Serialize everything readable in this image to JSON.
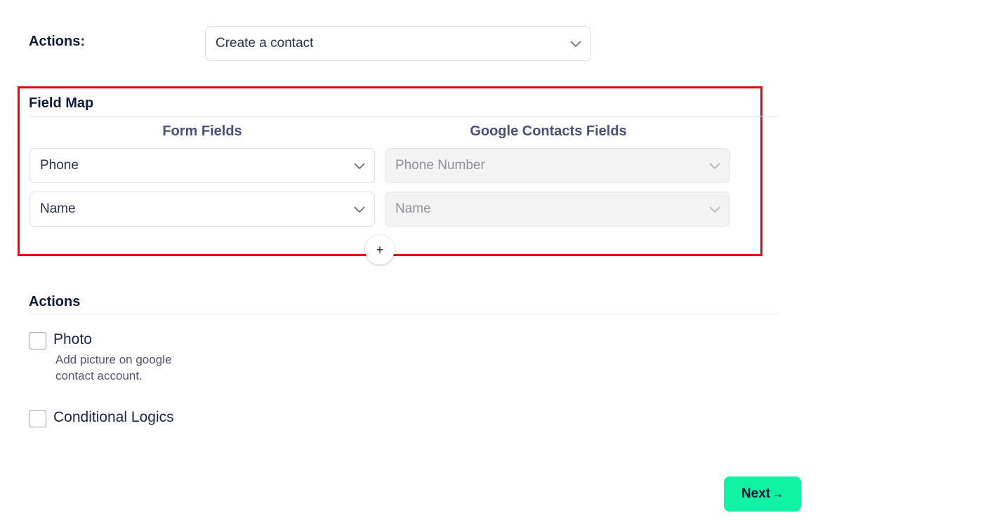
{
  "actions_row": {
    "label": "Actions:",
    "selected": "Create a contact"
  },
  "field_map": {
    "title": "Field Map",
    "form_fields_header": "Form Fields",
    "google_fields_header": "Google Contacts Fields",
    "rows": [
      {
        "form_field": "Phone",
        "google_field": "Phone Number"
      },
      {
        "form_field": "Name",
        "google_field": "Name"
      }
    ],
    "add_label": "+"
  },
  "actions_section": {
    "title": "Actions",
    "photo_label": "Photo",
    "photo_desc": "Add picture on google contact account.",
    "conditional_label": "Conditional Logics"
  },
  "next_button": {
    "label": "Next",
    "arrow": "→"
  },
  "colors": {
    "accent": "#12f2a4",
    "highlight": "#e8060b"
  },
  "icons": {
    "select": "chevron-down-icon",
    "add": "plus-icon",
    "next": "arrow-right-icon"
  }
}
